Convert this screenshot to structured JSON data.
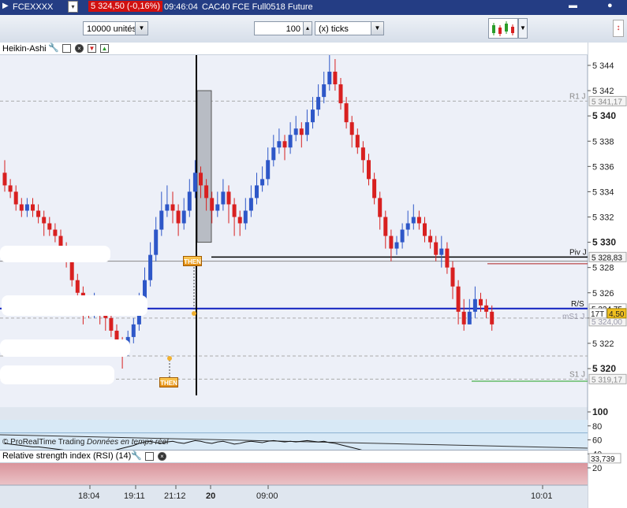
{
  "titlebar": {
    "symbol": "FCEXXXX",
    "price_change": "5 324,50 (-0,16%)",
    "time": "09:46:04",
    "instrument": "CAC40 FCE Full0518 Future"
  },
  "toolbar": {
    "units_value": "10000 unités",
    "ticks_count": "100",
    "ticks_unit": "(x) ticks"
  },
  "price_panel": {
    "indicator_label": "Heikin-Ashi",
    "copyright": "© ProRealTime Trading",
    "realtime": "Données en temps réel",
    "then_label": "THEN",
    "y_ticks": [
      "5 344",
      "5 342",
      "5 340",
      "5 338",
      "5 336",
      "5 334",
      "5 332",
      "5 330",
      "5 328",
      "5 326",
      "5 324",
      "5 322",
      "5 320"
    ],
    "levels": {
      "r1_label": "R1 J",
      "r1_value": "5 341,17",
      "piv_label": "Piv J",
      "piv_value": "5 328,83",
      "rs_label": "R/S",
      "current_value": "5 324,75",
      "spread_a": "17T",
      "spread_b": "4,50",
      "ms1_label": "mS1 J",
      "ms1_value": "5 324,00",
      "s1_label": "S1 J",
      "s1_value": "5 319,17"
    }
  },
  "rsi_panel": {
    "label": "Relative strength index (RSI) (14)",
    "y_ticks": [
      "100",
      "80",
      "60",
      "40",
      "20"
    ],
    "current_value": "33,739"
  },
  "x_axis": {
    "labels": [
      "18:04",
      "19:11",
      "21:12",
      "20",
      "09:00",
      "10:01"
    ]
  },
  "colors": {
    "bull": "#2e57c8",
    "bear": "#d82020",
    "background": "#edf0f8",
    "titlebar": "#243d84"
  },
  "candles": [
    [
      5335.5,
      5334.5,
      5336.5,
      5334.0
    ],
    [
      5334.5,
      5334.0,
      5335.0,
      5333.5
    ],
    [
      5334.0,
      5333.0,
      5334.5,
      5332.5
    ],
    [
      5333.0,
      5332.5,
      5333.5,
      5332.0
    ],
    [
      5332.5,
      5333.0,
      5333.5,
      5332.0
    ],
    [
      5333.0,
      5332.5,
      5333.5,
      5332.0
    ],
    [
      5332.5,
      5332.0,
      5333.0,
      5331.5
    ],
    [
      5332.0,
      5331.5,
      5332.5,
      5330.5
    ],
    [
      5331.5,
      5331.0,
      5332.0,
      5330.5
    ],
    [
      5331.0,
      5330.5,
      5331.5,
      5330.0
    ],
    [
      5330.5,
      5329.5,
      5331.0,
      5329.0
    ],
    [
      5329.5,
      5328.5,
      5330.0,
      5328.0
    ],
    [
      5328.5,
      5327.0,
      5329.0,
      5326.5
    ],
    [
      5327.0,
      5326.0,
      5327.5,
      5325.0
    ],
    [
      5326.0,
      5325.0,
      5326.5,
      5323.5
    ],
    [
      5325.0,
      5324.5,
      5325.5,
      5324.0
    ],
    [
      5324.5,
      5325.0,
      5326.0,
      5324.0
    ],
    [
      5325.0,
      5324.5,
      5325.5,
      5323.5
    ],
    [
      5324.5,
      5324.0,
      5325.0,
      5323.0
    ],
    [
      5324.0,
      5323.0,
      5324.5,
      5322.5
    ],
    [
      5323.0,
      5322.0,
      5323.5,
      5321.0
    ],
    [
      5322.0,
      5321.5,
      5322.5,
      5320.0
    ],
    [
      5321.5,
      5322.5,
      5323.0,
      5321.0
    ],
    [
      5322.5,
      5323.5,
      5324.0,
      5322.0
    ],
    [
      5323.5,
      5325.0,
      5326.0,
      5323.0
    ],
    [
      5325.0,
      5327.0,
      5328.0,
      5324.5
    ],
    [
      5327.0,
      5329.0,
      5330.0,
      5326.5
    ],
    [
      5329.0,
      5331.0,
      5332.0,
      5328.5
    ],
    [
      5331.0,
      5332.5,
      5334.0,
      5330.5
    ],
    [
      5332.5,
      5333.0,
      5334.5,
      5332.0
    ],
    [
      5333.0,
      5332.5,
      5334.0,
      5331.5
    ],
    [
      5332.5,
      5331.5,
      5333.0,
      5330.5
    ],
    [
      5331.5,
      5332.5,
      5333.5,
      5331.0
    ],
    [
      5332.5,
      5334.0,
      5335.0,
      5332.0
    ],
    [
      5334.0,
      5335.5,
      5336.5,
      5333.5
    ],
    [
      5335.5,
      5334.5,
      5336.0,
      5333.5
    ],
    [
      5334.5,
      5333.5,
      5335.0,
      5332.5
    ],
    [
      5333.5,
      5332.5,
      5334.0,
      5331.5
    ],
    [
      5332.5,
      5333.0,
      5334.0,
      5332.0
    ],
    [
      5333.0,
      5334.0,
      5335.0,
      5332.5
    ],
    [
      5334.0,
      5333.0,
      5334.5,
      5331.5
    ],
    [
      5333.0,
      5332.0,
      5333.5,
      5330.5
    ],
    [
      5332.0,
      5331.5,
      5332.5,
      5330.5
    ],
    [
      5331.5,
      5332.5,
      5333.5,
      5331.0
    ],
    [
      5332.5,
      5333.5,
      5334.5,
      5332.0
    ],
    [
      5333.5,
      5334.5,
      5335.5,
      5333.0
    ],
    [
      5334.5,
      5335.0,
      5336.0,
      5334.0
    ],
    [
      5335.0,
      5336.5,
      5337.5,
      5334.5
    ],
    [
      5336.5,
      5337.5,
      5338.5,
      5336.0
    ],
    [
      5337.5,
      5338.0,
      5339.0,
      5337.0
    ],
    [
      5338.0,
      5337.5,
      5338.5,
      5336.5
    ],
    [
      5337.5,
      5338.5,
      5339.5,
      5337.0
    ],
    [
      5338.5,
      5339.0,
      5340.0,
      5338.0
    ],
    [
      5339.0,
      5338.5,
      5339.5,
      5337.5
    ],
    [
      5338.5,
      5339.5,
      5340.5,
      5338.0
    ],
    [
      5339.5,
      5340.5,
      5341.5,
      5339.0
    ],
    [
      5340.5,
      5341.5,
      5342.5,
      5340.0
    ],
    [
      5341.5,
      5342.5,
      5343.5,
      5341.0
    ],
    [
      5342.5,
      5343.5,
      5345.0,
      5342.0
    ],
    [
      5343.5,
      5342.5,
      5344.5,
      5342.0
    ],
    [
      5342.5,
      5341.0,
      5343.0,
      5340.5
    ],
    [
      5341.0,
      5339.5,
      5341.5,
      5339.0
    ],
    [
      5339.5,
      5338.5,
      5340.0,
      5337.5
    ],
    [
      5338.5,
      5337.5,
      5339.0,
      5337.0
    ],
    [
      5337.5,
      5336.5,
      5338.0,
      5335.5
    ],
    [
      5336.5,
      5335.0,
      5337.0,
      5334.5
    ],
    [
      5335.0,
      5333.5,
      5335.5,
      5333.0
    ],
    [
      5333.5,
      5332.0,
      5334.0,
      5331.0
    ],
    [
      5332.0,
      5330.5,
      5332.5,
      5329.5
    ],
    [
      5330.5,
      5329.5,
      5331.0,
      5328.5
    ],
    [
      5329.5,
      5330.0,
      5330.5,
      5329.0
    ],
    [
      5330.0,
      5331.0,
      5331.5,
      5329.5
    ],
    [
      5331.0,
      5331.5,
      5332.5,
      5330.5
    ],
    [
      5331.5,
      5332.0,
      5333.0,
      5331.0
    ],
    [
      5332.0,
      5331.5,
      5332.5,
      5331.0
    ],
    [
      5331.5,
      5330.5,
      5332.0,
      5330.0
    ],
    [
      5330.5,
      5330.0,
      5331.0,
      5329.5
    ],
    [
      5330.0,
      5329.0,
      5330.5,
      5328.5
    ],
    [
      5329.0,
      5329.5,
      5330.5,
      5328.0
    ],
    [
      5329.5,
      5328.0,
      5330.0,
      5327.5
    ],
    [
      5328.0,
      5326.5,
      5328.5,
      5325.5
    ],
    [
      5326.5,
      5324.5,
      5327.0,
      5323.5
    ],
    [
      5324.5,
      5323.5,
      5325.5,
      5323.0
    ],
    [
      5323.5,
      5324.5,
      5325.5,
      5323.5
    ],
    [
      5324.5,
      5325.5,
      5326.5,
      5324.0
    ],
    [
      5325.5,
      5325.0,
      5326.0,
      5324.5
    ],
    [
      5325.0,
      5324.5,
      5325.5,
      5324.0
    ],
    [
      5324.5,
      5323.5,
      5325.0,
      5323.0
    ]
  ],
  "rsi_values": [
    55,
    54,
    53,
    52,
    51,
    50,
    50,
    49,
    48,
    47,
    46,
    45,
    43,
    42,
    41,
    40,
    41,
    42,
    43,
    44,
    46,
    48,
    50,
    52,
    55,
    57,
    58,
    56,
    55,
    57,
    58,
    56,
    55,
    57,
    59,
    58,
    56,
    55,
    57,
    58,
    56,
    54,
    55,
    57,
    58,
    57,
    56,
    58,
    59,
    58,
    57,
    58,
    57,
    58,
    59,
    58,
    57,
    58,
    56,
    55,
    53,
    51,
    49,
    47,
    45,
    44,
    42,
    40,
    38,
    36,
    37,
    38,
    39,
    38,
    37,
    36,
    35,
    34,
    33,
    34,
    33,
    32,
    34,
    35,
    34,
    33
  ]
}
